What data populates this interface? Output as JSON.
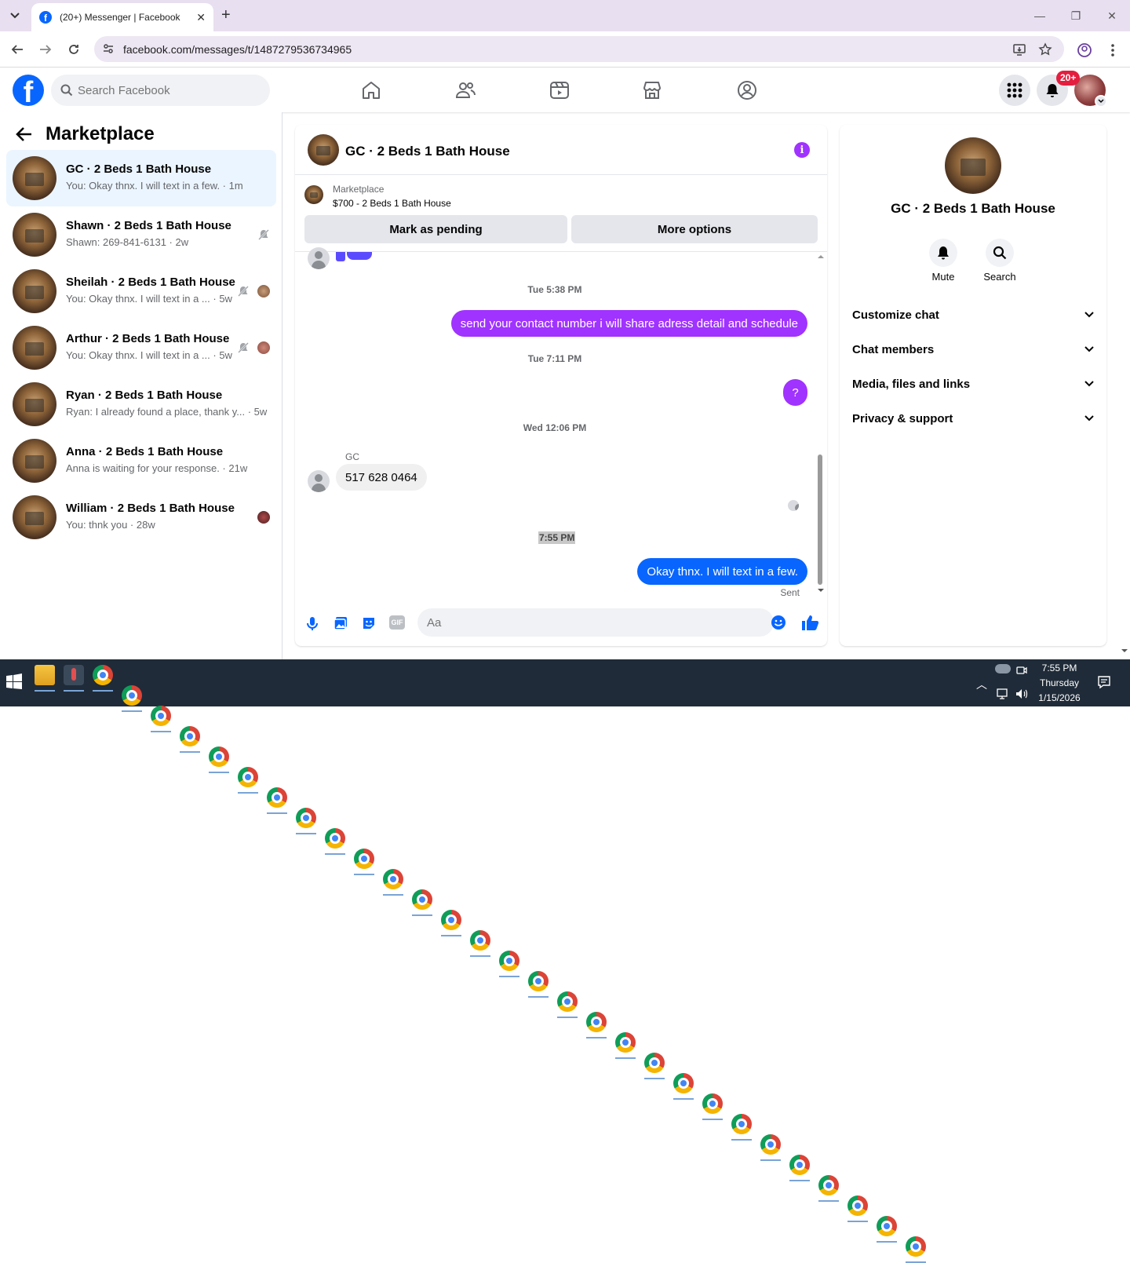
{
  "browser": {
    "tab_title": "(20+) Messenger | Facebook",
    "url": "facebook.com/messages/t/1487279536734965"
  },
  "fb": {
    "search_placeholder": "Search Facebook",
    "notification_badge": "20+",
    "brand_color": "#0866ff"
  },
  "sidebar": {
    "title": "Marketplace",
    "conversations": [
      {
        "name": "GC · 2 Beds 1 Bath House",
        "preview": "You: Okay thnx. I will text in a few. · 1m",
        "active": true
      },
      {
        "name": "Shawn · 2 Beds 1 Bath House",
        "preview": "Shawn: 269-841-6131 · 2w",
        "muted": true
      },
      {
        "name": "Sheilah · 2 Beds 1 Bath House",
        "preview": "You: Okay thnx. I will text in a ... · 5w",
        "muted": true
      },
      {
        "name": "Arthur · 2 Beds 1 Bath House",
        "preview": "You: Okay thnx. I will text in a ... · 5w",
        "muted": true
      },
      {
        "name": "Ryan · 2 Beds 1 Bath House",
        "preview": "Ryan: I already found a place, thank y... · 5w"
      },
      {
        "name": "Anna · 2 Beds 1 Bath House",
        "preview": "Anna is waiting for your response. · 21w"
      },
      {
        "name": "William · 2 Beds 1 Bath House",
        "preview": "You: thnk you · 28w"
      }
    ]
  },
  "chat": {
    "title": "GC · 2 Beds 1 Bath House",
    "listing_source": "Marketplace",
    "listing_title": "$700 - 2 Beds 1 Bath House",
    "mark_pending_label": "Mark as pending",
    "more_options_label": "More options",
    "messages": [
      {
        "type": "timestamp",
        "text": "Tue 5:38 PM"
      },
      {
        "type": "out",
        "text": "send your contact number i will share adress detail and schedule"
      },
      {
        "type": "timestamp",
        "text": "Tue 7:11 PM"
      },
      {
        "type": "out",
        "text": "?"
      },
      {
        "type": "timestamp",
        "text": "Wed 12:06 PM"
      },
      {
        "type": "sender",
        "text": "GC"
      },
      {
        "type": "in",
        "text": "517 628 0464"
      },
      {
        "type": "timestamp",
        "text": "7:55 PM"
      },
      {
        "type": "out_blue",
        "text": "Okay thnx. I will text in a few."
      },
      {
        "type": "status",
        "text": "Sent"
      }
    ],
    "input_placeholder": "Aa",
    "accent_color": "#a033ff"
  },
  "details": {
    "name": "GC · 2 Beds 1 Bath House",
    "mute_label": "Mute",
    "search_label": "Search",
    "sections": [
      "Customize chat",
      "Chat members",
      "Media, files and links",
      "Privacy & support"
    ]
  },
  "taskbar": {
    "time": "7:55 PM",
    "day": "Thursday",
    "date": "1/15/2026"
  }
}
